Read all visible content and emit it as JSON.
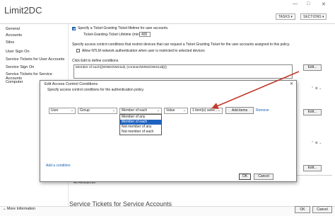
{
  "window": {
    "title": "Limit2DC",
    "min_glyph": "—",
    "max_glyph": "□",
    "close_glyph": "✕",
    "tasks_label": "TASKS",
    "sections_label": "SECTIONS"
  },
  "nav": {
    "items": [
      "General",
      "Accounts",
      "Silos",
      "User Sign On",
      "Service Tickets for User Accounts",
      "Service Sign On",
      "Service Tickets for Service Accounts",
      "Computer"
    ]
  },
  "content": {
    "tgt_checkbox_label": "Specify a Ticket Granting Ticket lifetime for user accounts.",
    "tgt_lifetime_label": "Ticket-Granting-Ticket Lifetime (minutes):",
    "tgt_lifetime_value": "400",
    "restrict_text": "Specify access control conditions that restrict devices that can request a Ticket Granting Ticket for the user accounts assigned to this policy.",
    "ntlm_label": "Allow NTLM network authentication when user is restricted to selected devices",
    "edit_hint": "Click Edit to define conditions",
    "condition_value": "Member of each({WINDOWS11$, (contoso\\WINDOWS11$)})",
    "edit_button": "Edit...",
    "all_resources": "All Resources",
    "section_title": "Service Tickets for Service Accounts",
    "side_ctrl": "⌃ ⊗ ⌄"
  },
  "footer": {
    "more_info": "More Information",
    "ok_label": "OK",
    "cancel_label": "Cancel"
  },
  "dialog": {
    "title": "Edit Access Control Conditions",
    "close_glyph": "✕",
    "description": "Specify access control conditions for the authentication policy.",
    "row": {
      "subject": "User",
      "attribute": "Group",
      "operator": "Member of each",
      "value_type": "Value",
      "value": "1 item(s) selec...",
      "add_items": "Add items",
      "remove": "Remove"
    },
    "operator_options": [
      "Member of any",
      "Member of each",
      "Not member of any",
      "Not member of each"
    ],
    "operator_selected_index": 1,
    "add_condition": "Add a condition",
    "ok_label": "OK",
    "cancel_label": "Cancel"
  },
  "colors": {
    "accent": "#1e62c0",
    "arrow": "#c0392b",
    "link": "#1a5fb4"
  }
}
